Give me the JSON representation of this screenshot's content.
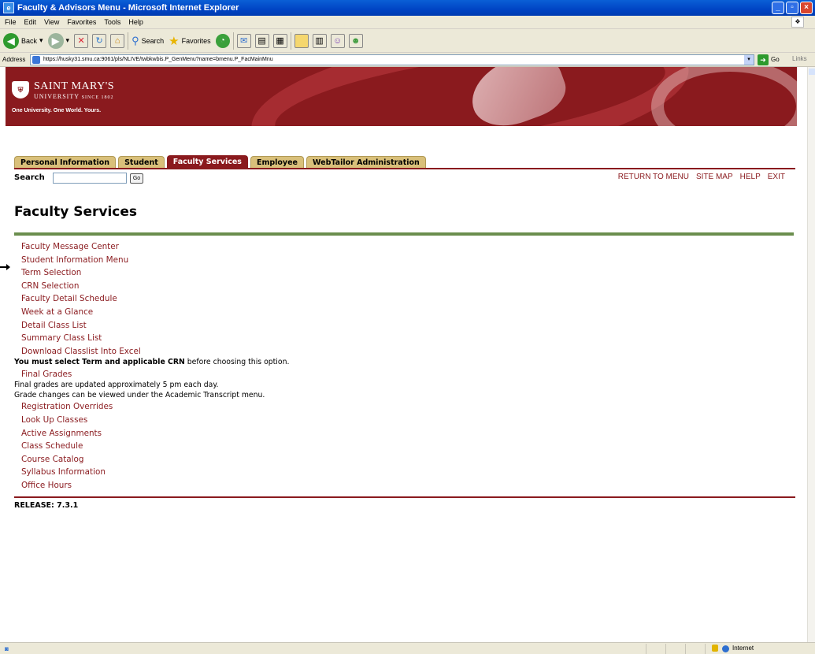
{
  "window": {
    "title": "Faculty & Advisors Menu - Microsoft Internet Explorer"
  },
  "menubar": {
    "items": [
      "File",
      "Edit",
      "View",
      "Favorites",
      "Tools",
      "Help"
    ]
  },
  "toolbar": {
    "back": "Back",
    "search": "Search",
    "favorites": "Favorites"
  },
  "address": {
    "label": "Address",
    "url": "https://husky31.smu.ca:9061/pls/NLIVE/twbkwbis.P_GenMenu?name=bmenu.P_FacMainMnu",
    "go": "Go",
    "links": "Links"
  },
  "banner": {
    "name": "SAINT MARY'S",
    "sub": "UNIVERSITY",
    "since": "SINCE 1802",
    "tagline": "One University. One World. Yours."
  },
  "tabs": [
    "Personal Information",
    "Student",
    "Faculty Services",
    "Employee",
    "WebTailor Administration"
  ],
  "search": {
    "label": "Search",
    "go": "Go"
  },
  "toplinks": [
    "RETURN TO MENU",
    "SITE MAP",
    "HELP",
    "EXIT"
  ],
  "page": {
    "title": "Faculty Services",
    "release": "RELEASE: 7.3.1"
  },
  "menu": [
    "Faculty Message Center",
    "Student Information Menu",
    "Term Selection",
    "CRN Selection",
    "Faculty Detail Schedule",
    "Week at a Glance",
    "Detail Class List",
    "Summary Class List",
    "Download Classlist Into Excel"
  ],
  "notes": {
    "download": {
      "bold": "You must select Term and applicable CRN",
      "rest": " before choosing this option."
    },
    "final1": "Final grades are updated approximately 5 pm each day.",
    "final2": "Grade changes can be viewed under the Academic Transcript menu."
  },
  "final_grades": "Final Grades",
  "menu2": [
    "Registration Overrides",
    "Look Up Classes",
    "Active Assignments",
    "Class Schedule",
    "Course Catalog",
    "Syllabus Information",
    "Office Hours"
  ],
  "status": {
    "zone": "Internet"
  },
  "colors": {
    "brand": "#8a1a1e",
    "accent": "#6b8e4e",
    "tab": "#d9c07a"
  }
}
